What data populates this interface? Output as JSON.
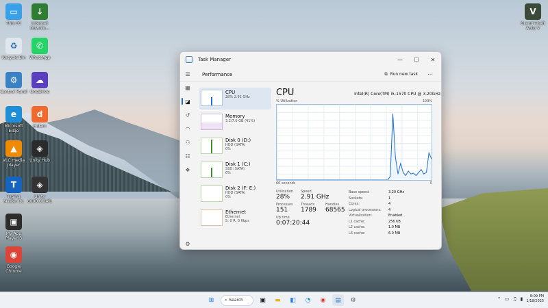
{
  "desktop": {
    "icons": [
      {
        "label": "This PC",
        "icon": "this-pc-icon",
        "color": "#3aa0e8",
        "glyph": "▭"
      },
      {
        "label": "Internet Downlo...",
        "icon": "idm-icon",
        "color": "#2e7d32",
        "glyph": "↓"
      },
      {
        "label": "Recycle Bin",
        "icon": "recycle-bin-icon",
        "color": "#dfe7ee",
        "glyph": "♻"
      },
      {
        "label": "WhatsApp",
        "icon": "whatsapp-icon",
        "color": "#25d366",
        "glyph": "✆"
      },
      {
        "label": "Control Panel",
        "icon": "control-panel-icon",
        "color": "#3b82c4",
        "glyph": "⚙"
      },
      {
        "label": "OneDrive",
        "icon": "onedrive-icon",
        "color": "#5b3fbf",
        "glyph": "☁"
      },
      {
        "label": "Microsoft Edge",
        "icon": "edge-icon",
        "color": "#1e8fd6",
        "glyph": "e"
      },
      {
        "label": "Hulam",
        "icon": "hulam-icon",
        "color": "#f06a30",
        "glyph": "d"
      },
      {
        "label": "VLC media player",
        "icon": "vlc-icon",
        "color": "#f08a00",
        "glyph": "▲"
      },
      {
        "label": "Unity Hub",
        "icon": "unity-hub-icon",
        "color": "#2b2b2b",
        "glyph": "◈"
      },
      {
        "label": "Typing Master 11",
        "icon": "typing-master-icon",
        "color": "#1565c0",
        "glyph": "T"
      },
      {
        "label": "Unity 6000.0.34f1",
        "icon": "unity-icon",
        "color": "#333333",
        "glyph": "◈"
      },
      {
        "label": "My App Player 3",
        "icon": "app-player-icon",
        "color": "#2d2d2d",
        "glyph": "▣"
      },
      {
        "label": "Google Chrome",
        "icon": "chrome-icon",
        "color": "#db4437",
        "glyph": "◉"
      },
      {
        "label": "Grand Theft Auto V",
        "icon": "gta-v-icon",
        "color": "#3c4a3a",
        "glyph": "V"
      }
    ]
  },
  "window": {
    "title": "Task Manager",
    "section": "Performance",
    "run_new_task": "Run new task",
    "more": "⋯",
    "minimize": "—",
    "maximize": "☐",
    "close": "✕"
  },
  "resources": [
    {
      "name": "CPU",
      "sub": "28% 2.91 GHz",
      "color": "#1c6dd0"
    },
    {
      "name": "Memory",
      "sub": "3.2/7.6 GB (41%)",
      "color": "#8b3fbf"
    },
    {
      "name": "Disk 0 (D:)",
      "sub1": "HDD (SATA)",
      "sub2": "0%",
      "color": "#3f8f2f"
    },
    {
      "name": "Disk 1 (C:)",
      "sub1": "SSD (SATA)",
      "sub2": "0%",
      "color": "#3f8f2f"
    },
    {
      "name": "Disk 2 (F: E:)",
      "sub1": "HDD (SATA)",
      "sub2": "0%",
      "color": "#3f8f2f"
    },
    {
      "name": "Ethernet",
      "sub1": "Ethernet",
      "sub2": "S: 0 R: 0 Kbps",
      "color": "#a2562a"
    }
  ],
  "cpu": {
    "title": "CPU",
    "model": "Intel(R) Core(TM) i5-1570 CPU @ 3.20GHz",
    "util_label": "% Utilization",
    "max_label": "100%",
    "seconds_label": "60 seconds",
    "min_label": "0",
    "stats": {
      "utilization_label": "Utilization",
      "utilization": "28%",
      "speed_label": "Speed",
      "speed": "2.91 GHz",
      "processes_label": "Processes",
      "processes": "151",
      "threads_label": "Threads",
      "threads": "1789",
      "handles_label": "Handles",
      "handles": "68565",
      "uptime_label": "Up time",
      "uptime": "0:07:20:44"
    },
    "details": [
      {
        "k": "Base speed:",
        "v": "3.20 GHz"
      },
      {
        "k": "Sockets:",
        "v": "1"
      },
      {
        "k": "Cores:",
        "v": "4"
      },
      {
        "k": "Logical processors:",
        "v": "4"
      },
      {
        "k": "Virtualization:",
        "v": "Enabled"
      },
      {
        "k": "L1 cache:",
        "v": "256 KB"
      },
      {
        "k": "L2 cache:",
        "v": "1.0 MB"
      },
      {
        "k": "L3 cache:",
        "v": "6.0 MB"
      }
    ]
  },
  "chart_data": {
    "type": "line",
    "title": "",
    "ylabel": "% Utilization",
    "xlabel": "60 seconds",
    "ylim": [
      0,
      100
    ],
    "x": [
      0,
      1,
      2,
      3,
      4,
      5,
      6,
      7,
      8,
      9,
      10,
      11,
      12,
      13,
      14,
      15,
      16,
      17,
      18,
      19,
      20,
      21,
      22,
      23,
      24,
      25,
      26,
      27,
      28,
      29,
      30,
      31,
      32,
      33,
      34,
      35,
      36,
      37,
      38,
      39,
      40,
      41,
      42,
      43,
      44,
      45,
      46,
      47,
      48,
      49,
      50,
      51,
      52,
      53,
      54,
      55,
      56,
      57,
      58,
      59,
      60
    ],
    "series": [
      {
        "values": [
          0,
          0,
          0,
          0,
          0,
          0,
          0,
          0,
          0,
          0,
          0,
          0,
          0,
          0,
          0,
          0,
          0,
          0,
          0,
          0,
          0,
          0,
          0,
          0,
          0,
          0,
          0,
          0,
          0,
          0,
          0,
          0,
          0,
          0,
          0,
          0,
          0,
          0,
          0,
          0,
          0,
          0,
          0,
          0,
          0,
          0,
          0,
          0,
          0,
          0,
          0,
          0,
          0,
          0,
          0,
          0,
          0,
          0,
          0,
          0,
          0
        ]
      },
      {
        "values": [
          null,
          null,
          null,
          null,
          null,
          null,
          null,
          null,
          null,
          null,
          null,
          null,
          null,
          null,
          null,
          null,
          null,
          null,
          null,
          null,
          null,
          null,
          null,
          null,
          null,
          null,
          null,
          null,
          null,
          null,
          null,
          null,
          null,
          null,
          null,
          null,
          null,
          null,
          null,
          null,
          null,
          null,
          null,
          null,
          null,
          null,
          null,
          null,
          null,
          null,
          null,
          null,
          null,
          null,
          null,
          null,
          null,
          null,
          null,
          null,
          null
        ]
      }
    ],
    "trace": [
      [
        0,
        0
      ],
      [
        43,
        0
      ],
      [
        44,
        5
      ],
      [
        45,
        88
      ],
      [
        46,
        30
      ],
      [
        47,
        8
      ],
      [
        48,
        22
      ],
      [
        49,
        10
      ],
      [
        50,
        6
      ],
      [
        51,
        12
      ],
      [
        52,
        8
      ],
      [
        53,
        9
      ],
      [
        54,
        6
      ],
      [
        55,
        10
      ],
      [
        56,
        14
      ],
      [
        57,
        8
      ],
      [
        58,
        10
      ],
      [
        59,
        36
      ],
      [
        60,
        28
      ]
    ]
  },
  "taskbar": {
    "search_label": "Search",
    "time": "8:09 PM",
    "date": "1/18/2025"
  }
}
